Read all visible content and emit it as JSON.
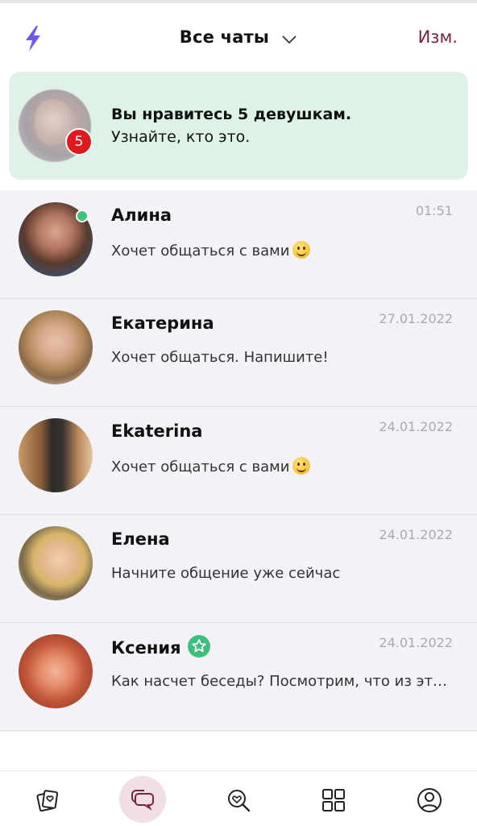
{
  "header": {
    "title": "Все чаты",
    "edit_label": "Изм."
  },
  "promo": {
    "title": "Вы нравитесь 5 девушкам.",
    "subtitle": "Узнайте, кто это.",
    "badge_count": "5"
  },
  "chats": [
    {
      "name": "Алина",
      "time": "01:51",
      "message": "Хочет общаться с вами",
      "emoji": "slightly-smiling-face",
      "online": true
    },
    {
      "name": "Екатерина",
      "time": "27.01.2022",
      "message": "Хочет общаться. Напишите!"
    },
    {
      "name": "Ekaterina",
      "time": "24.01.2022",
      "message": "Хочет общаться с вами",
      "emoji": "slightly-smiling-face"
    },
    {
      "name": "Елена",
      "time": "24.01.2022",
      "message": "Начните общение уже сейчас"
    },
    {
      "name": "Ксения",
      "time": "24.01.2022",
      "message": "Как насчет беседы? Посмотрим, что из эт…",
      "verified": true
    }
  ],
  "colors": {
    "accent": "#7a2340",
    "online": "#3ec47a",
    "badge": "#e0191f",
    "promo_bg": "#dff2e7",
    "bolt": "#6b5cf0"
  },
  "bottom_nav": {
    "items": [
      {
        "icon": "cards-icon"
      },
      {
        "icon": "chat-bubbles-icon",
        "active": true
      },
      {
        "icon": "search-heart-icon"
      },
      {
        "icon": "grid-icon"
      },
      {
        "icon": "profile-icon"
      }
    ]
  }
}
